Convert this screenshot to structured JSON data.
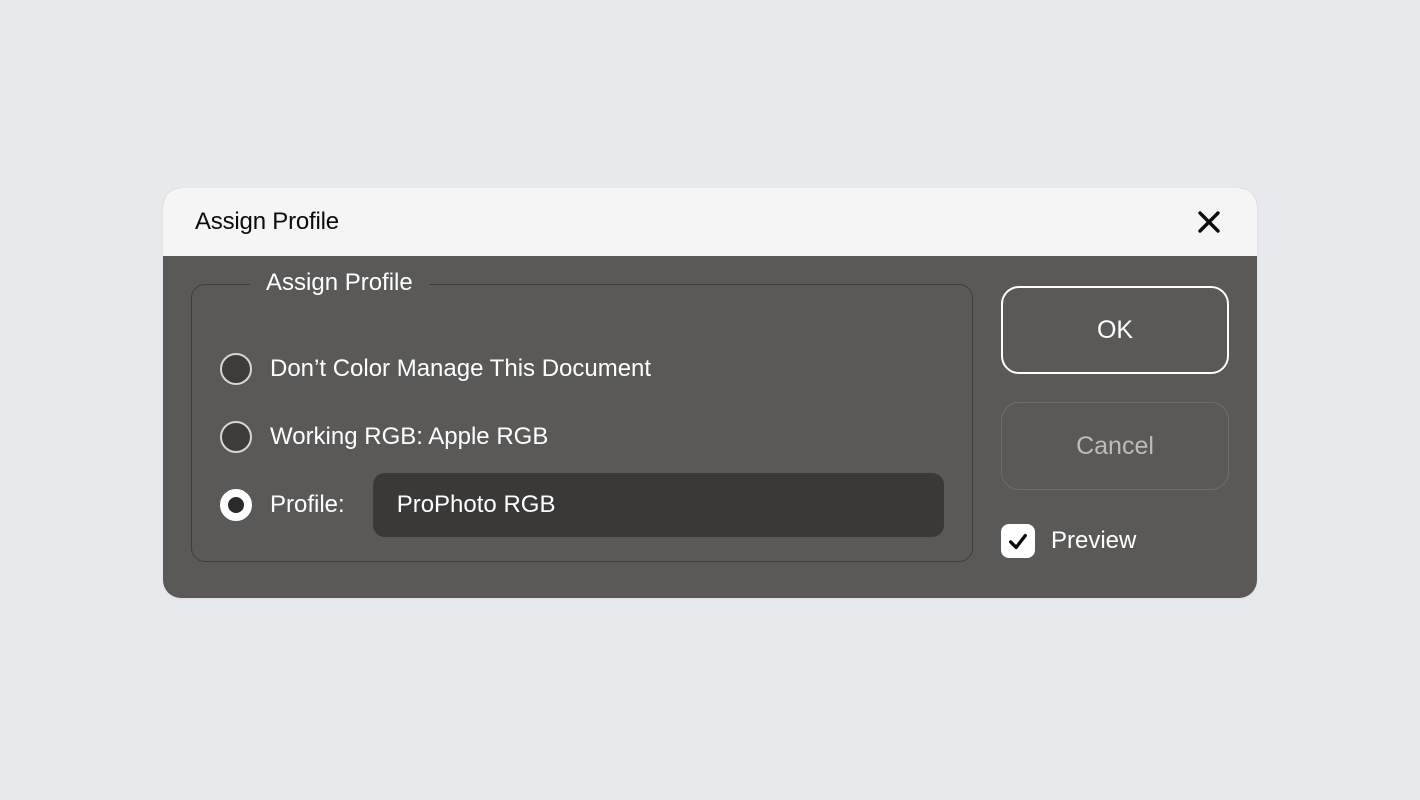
{
  "dialog": {
    "title": "Assign Profile",
    "close_icon": "close"
  },
  "fieldset": {
    "legend": "Assign Profile",
    "options": [
      {
        "label": "Don’t Color Manage This Document",
        "selected": false
      },
      {
        "label": "Working RGB: Apple RGB",
        "selected": false
      },
      {
        "label": "Profile:",
        "selected": true
      }
    ],
    "profile_value": "ProPhoto RGB"
  },
  "buttons": {
    "ok": "OK",
    "cancel": "Cancel"
  },
  "preview": {
    "label": "Preview",
    "checked": true
  }
}
